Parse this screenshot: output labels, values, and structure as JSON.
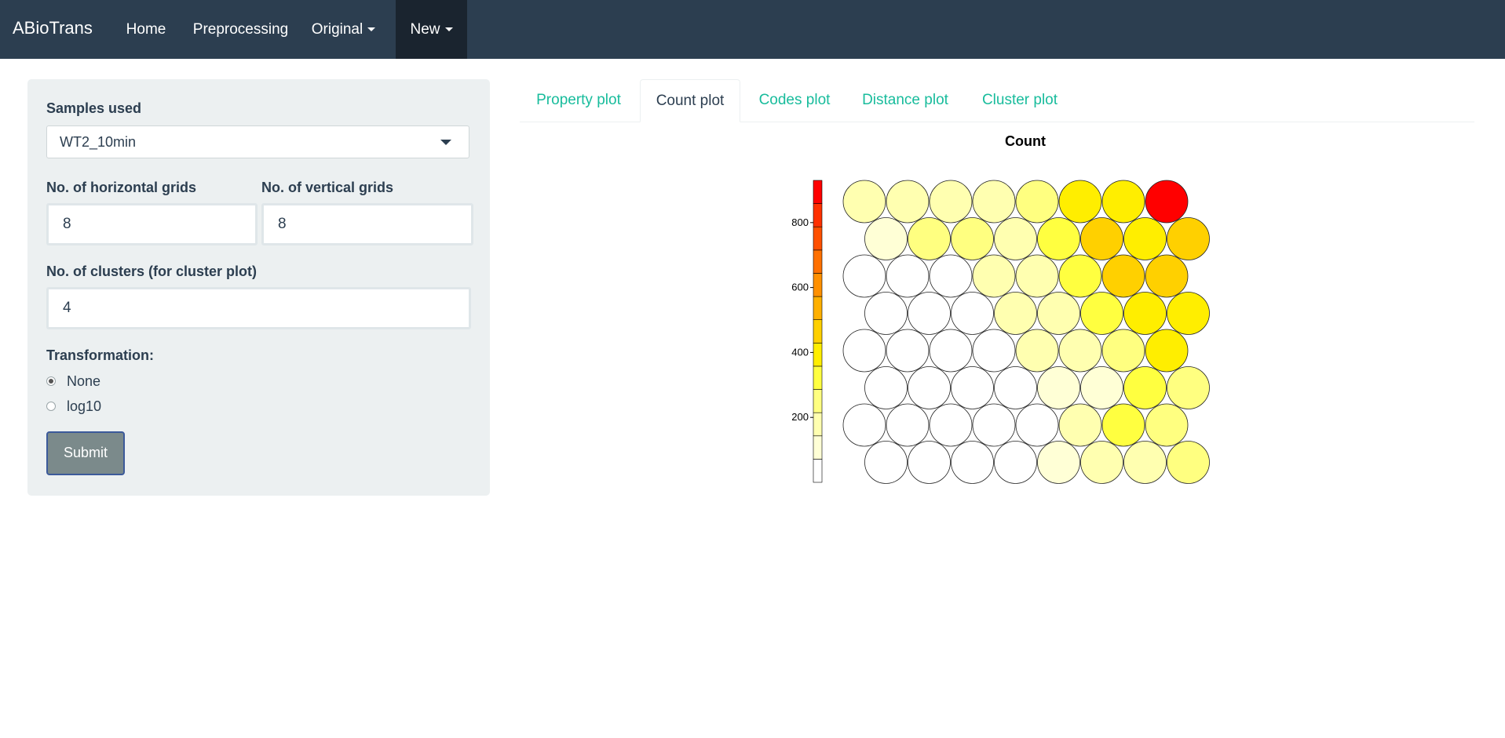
{
  "navbar": {
    "brand": "ABioTrans",
    "items": [
      {
        "label": "Home",
        "dropdown": false,
        "active": false
      },
      {
        "label": "Preprocessing",
        "dropdown": false,
        "active": false
      },
      {
        "label": "Original",
        "dropdown": true,
        "active": false
      },
      {
        "label": "New",
        "dropdown": true,
        "active": true
      }
    ]
  },
  "sidebar": {
    "samples_label": "Samples used",
    "samples_value": "WT2_10min",
    "hgrid_label": "No. of horizontal grids",
    "hgrid_value": "8",
    "vgrid_label": "No. of vertical grids",
    "vgrid_value": "8",
    "clusters_label": "No. of clusters (for cluster plot)",
    "clusters_value": "4",
    "transformation_label": "Transformation:",
    "transformation_options": [
      {
        "label": "None",
        "checked": true
      },
      {
        "label": "log10",
        "checked": false
      }
    ],
    "submit_label": "Submit"
  },
  "tabs": [
    {
      "label": "Property plot",
      "active": false
    },
    {
      "label": "Count plot",
      "active": true
    },
    {
      "label": "Codes plot",
      "active": false
    },
    {
      "label": "Distance plot",
      "active": false
    },
    {
      "label": "Cluster plot",
      "active": false
    }
  ],
  "chart_data": {
    "type": "heatmap",
    "title": "Count",
    "colorbar": {
      "range": [
        0,
        930
      ],
      "ticks": [
        200,
        400,
        600,
        800
      ],
      "palette": [
        "#ffffff",
        "#ffffd6",
        "#ffffb0",
        "#ffff80",
        "#ffff40",
        "#ffee00",
        "#ffd000",
        "#ffb000",
        "#ff9000",
        "#ff7000",
        "#ff5000",
        "#ff3000",
        "#ff0000"
      ]
    },
    "grid": {
      "cols": 8,
      "rows": 8,
      "layout": "hexagonal"
    },
    "values": [
      [
        200,
        190,
        180,
        200,
        280,
        410,
        400,
        930
      ],
      [
        90,
        230,
        250,
        210,
        320,
        430,
        380,
        480
      ],
      [
        60,
        60,
        40,
        210,
        200,
        340,
        440,
        430
      ],
      [
        70,
        50,
        60,
        190,
        210,
        350,
        420,
        400
      ],
      [
        60,
        60,
        50,
        60,
        200,
        170,
        270,
        410
      ],
      [
        60,
        50,
        50,
        40,
        130,
        140,
        320,
        240
      ],
      [
        60,
        70,
        50,
        40,
        60,
        180,
        330,
        280
      ],
      [
        40,
        70,
        50,
        50,
        130,
        150,
        160,
        280
      ]
    ]
  }
}
